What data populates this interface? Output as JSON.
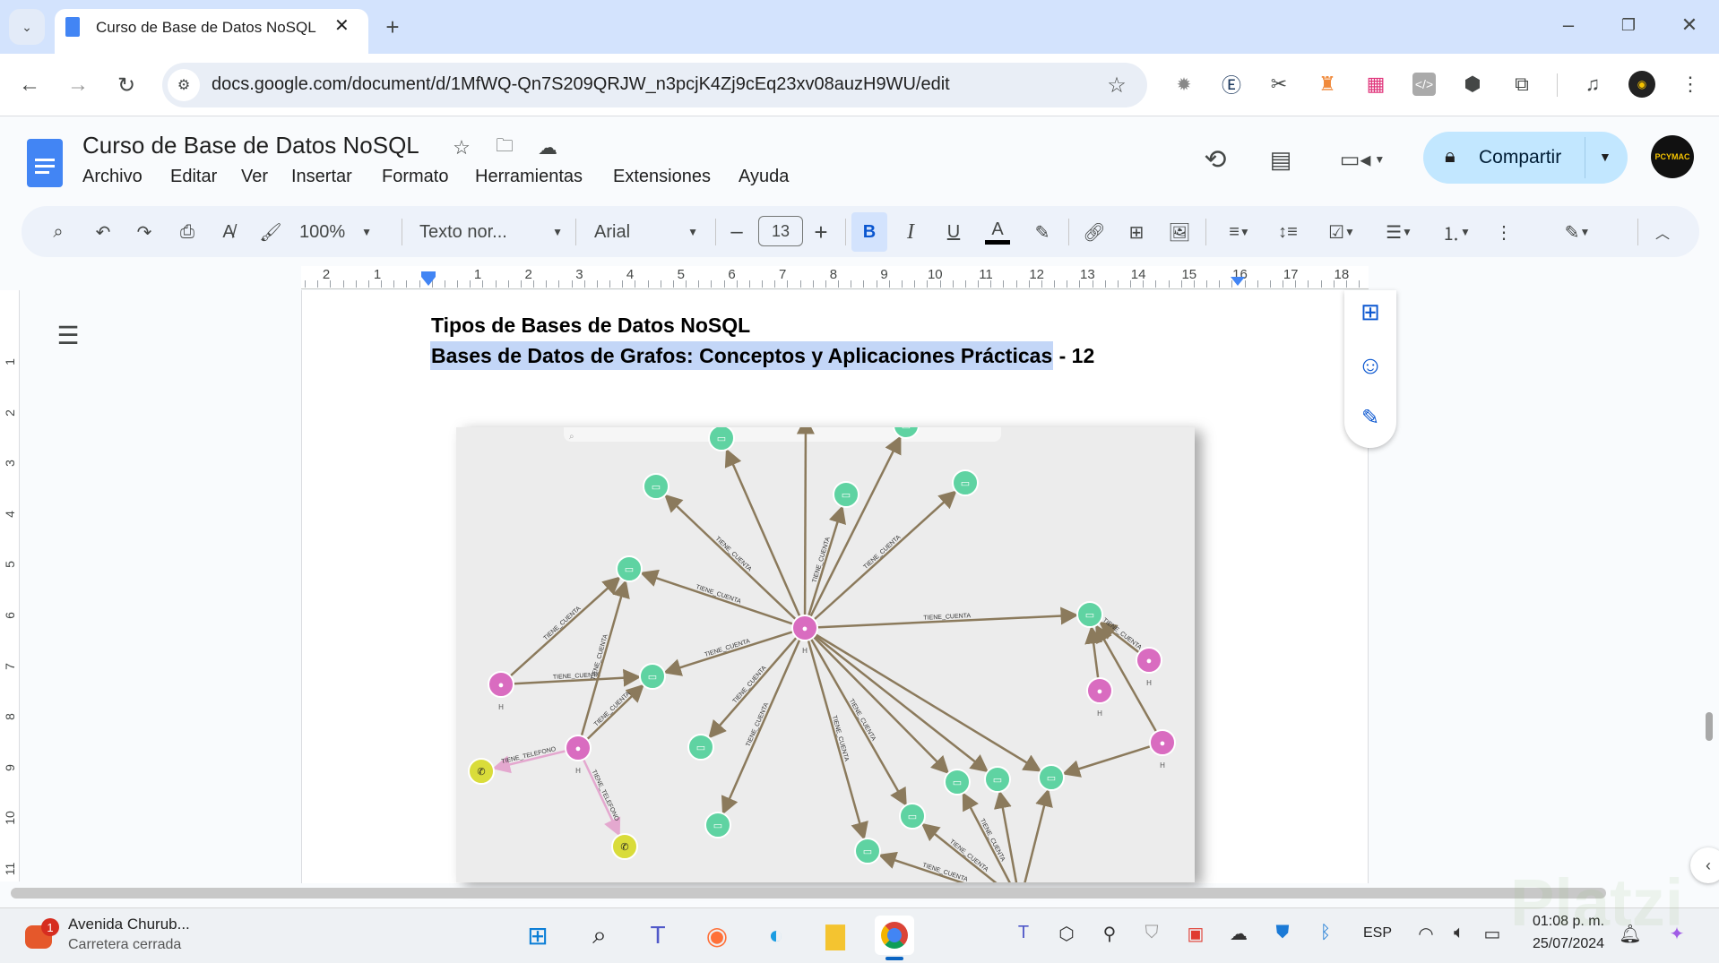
{
  "browser": {
    "tab_title": "Curso de Base de Datos NoSQL",
    "url": "docs.google.com/document/d/1MfWQ-Qn7S209QRJW_n3pcjK4Zj9cEq23xv08auzH9WU/edit"
  },
  "docs": {
    "title": "Curso de Base de Datos NoSQL",
    "menu": [
      "Archivo",
      "Editar",
      "Ver",
      "Insertar",
      "Formato",
      "Herramientas",
      "Extensiones",
      "Ayuda"
    ],
    "share_label": "Compartir",
    "avatar_text": "PCYMAC"
  },
  "toolbar": {
    "zoom": "100%",
    "style": "Texto nor...",
    "font": "Arial",
    "font_size": "13",
    "minus": "–",
    "plus": "+",
    "bold": "B",
    "italic": "I",
    "underline": "U",
    "text_color": "A"
  },
  "ruler": {
    "left": [
      "2",
      "1"
    ],
    "right": [
      "1",
      "2",
      "3",
      "4",
      "5",
      "6",
      "7",
      "8",
      "9",
      "10",
      "11",
      "12",
      "13",
      "14",
      "15",
      "16",
      "17",
      "18"
    ],
    "vertical": [
      "1",
      "2",
      "3",
      "4",
      "5",
      "6",
      "7",
      "8",
      "9",
      "10",
      "11"
    ]
  },
  "document": {
    "heading": "Tipos de Bases de Datos NoSQL",
    "subheading_highlighted": "Bases de Datos de Grafos: Conceptos y Aplicaciones Prácticas",
    "subheading_suffix": " - 12",
    "highlight_color": "#c3d6f7"
  },
  "graph_image": {
    "edge_label_account": "TIENE_CUENTA",
    "edge_label_phone": "TIENE_TELEFONO",
    "node_caption": "H",
    "colors": {
      "person": "#d96cc0",
      "account": "#5fd3a2",
      "phone": "#d9dc3a",
      "edge": "#8b7a5c"
    }
  },
  "taskbar": {
    "notification_title": "Avenida Churub...",
    "notification_sub": "Carretera cerrada",
    "notification_badge": "1",
    "language": "ESP",
    "time": "01:08 p. m.",
    "date": "25/07/2024",
    "watermark": "Platzi"
  }
}
